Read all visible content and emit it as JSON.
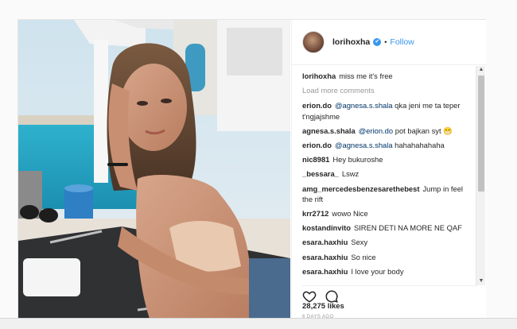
{
  "post": {
    "username": "lorihoxha",
    "verified_mark": "✔",
    "separator": "•",
    "follow_label": "Follow",
    "caption_user": "lorihoxha",
    "caption_text": "miss me it's free",
    "load_more": "Load more comments",
    "comments": [
      {
        "user": "erion.do",
        "mention": "@agnesa.s.shala",
        "text": " qka jeni me ta teper t'ngjajshme"
      },
      {
        "user": "agnesa.s.shala",
        "mention": "@erion.do",
        "text": " pot bajkan syt 😁"
      },
      {
        "user": "erion.do",
        "mention": "@agnesa.s.shala",
        "text": " hahahahahaha"
      },
      {
        "user": "nic8981",
        "mention": "",
        "text": "Hey bukuroshe"
      },
      {
        "user": "_bessara_",
        "mention": "",
        "text": "Lswz"
      },
      {
        "user": "amg_mercedesbenzesarethebest",
        "mention": "",
        "text": "Jump in feel the rift"
      },
      {
        "user": "krr2712",
        "mention": "",
        "text": "wowo Nice"
      },
      {
        "user": "kostandinvito",
        "mention": "",
        "text": "SIREN DETI NA MORE NE QAF"
      },
      {
        "user": "esara.haxhiu",
        "mention": "",
        "text": "Sexy"
      },
      {
        "user": "esara.haxhiu",
        "mention": "",
        "text": "So nice"
      },
      {
        "user": "esara.haxhiu",
        "mention": "",
        "text": "I love your body"
      }
    ],
    "likes": "28,275 likes",
    "time_ago": "6 DAYS AGO",
    "icons": {
      "like": "heart-icon",
      "comment": "comment-icon",
      "scroll_up": "▲",
      "scroll_down": "▼"
    }
  },
  "colors": {
    "link": "#3897f0",
    "text": "#262626",
    "muted": "#999999",
    "border": "#efefef"
  }
}
